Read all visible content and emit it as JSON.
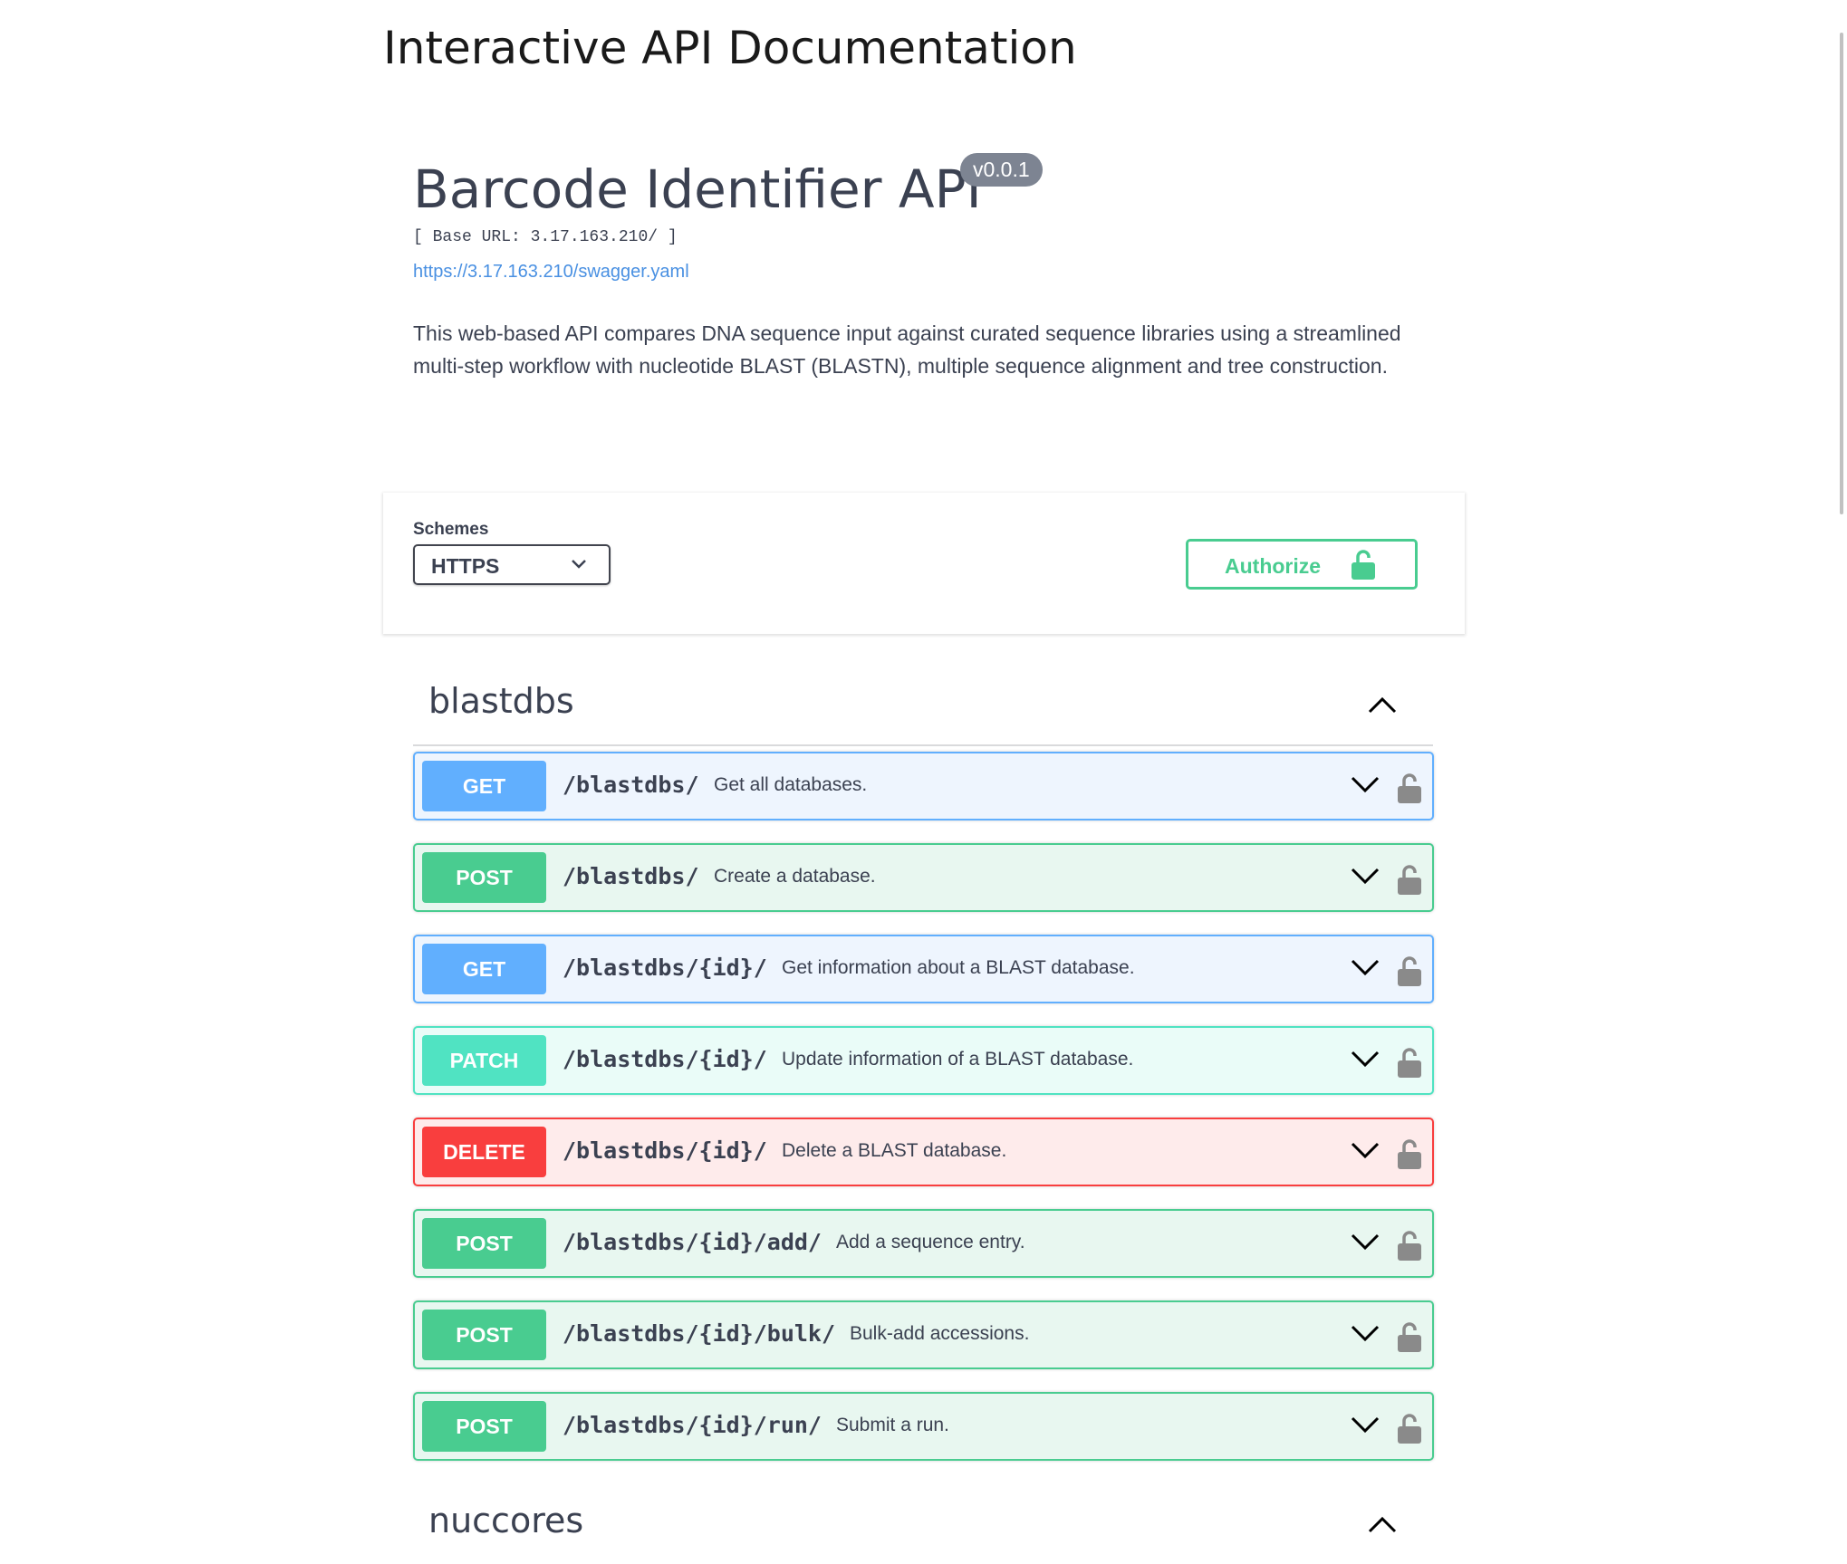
{
  "page": {
    "heading": "Interactive API Documentation"
  },
  "info": {
    "title": "Barcode Identifier API",
    "version": "v0.0.1",
    "base_url": "[ Base URL: 3.17.163.210/ ]",
    "spec_link": "https://3.17.163.210/swagger.yaml",
    "description": "This web-based API compares DNA sequence input against curated sequence libraries using a streamlined multi-step workflow with nucleotide BLAST (BLASTN), multiple sequence alignment and tree construction."
  },
  "schemes": {
    "label": "Schemes",
    "selected": "HTTPS"
  },
  "authorize": {
    "label": "Authorize"
  },
  "tags": [
    {
      "name": "blastdbs"
    },
    {
      "name": "nuccores"
    }
  ],
  "operations": [
    {
      "method": "GET",
      "path": "/blastdbs/",
      "summary": "Get all databases."
    },
    {
      "method": "POST",
      "path": "/blastdbs/",
      "summary": "Create a database."
    },
    {
      "method": "GET",
      "path": "/blastdbs/{id}/",
      "summary": "Get information about a BLAST database."
    },
    {
      "method": "PATCH",
      "path": "/blastdbs/{id}/",
      "summary": "Update information of a BLAST database."
    },
    {
      "method": "DELETE",
      "path": "/blastdbs/{id}/",
      "summary": "Delete a BLAST database."
    },
    {
      "method": "POST",
      "path": "/blastdbs/{id}/add/",
      "summary": "Add a sequence entry."
    },
    {
      "method": "POST",
      "path": "/blastdbs/{id}/bulk/",
      "summary": "Bulk-add accessions."
    },
    {
      "method": "POST",
      "path": "/blastdbs/{id}/run/",
      "summary": "Submit a run."
    }
  ],
  "colors": {
    "GET": {
      "badge": "#61affe",
      "border": "#61affe",
      "bg": "#eef5fe"
    },
    "POST": {
      "badge": "#49cc90",
      "border": "#49cc90",
      "bg": "#e8f7f0"
    },
    "PATCH": {
      "badge": "#50e3c2",
      "border": "#50e3c2",
      "bg": "#eafcf8"
    },
    "DELETE": {
      "badge": "#f93e3e",
      "border": "#f93e3e",
      "bg": "#feebeb"
    }
  }
}
